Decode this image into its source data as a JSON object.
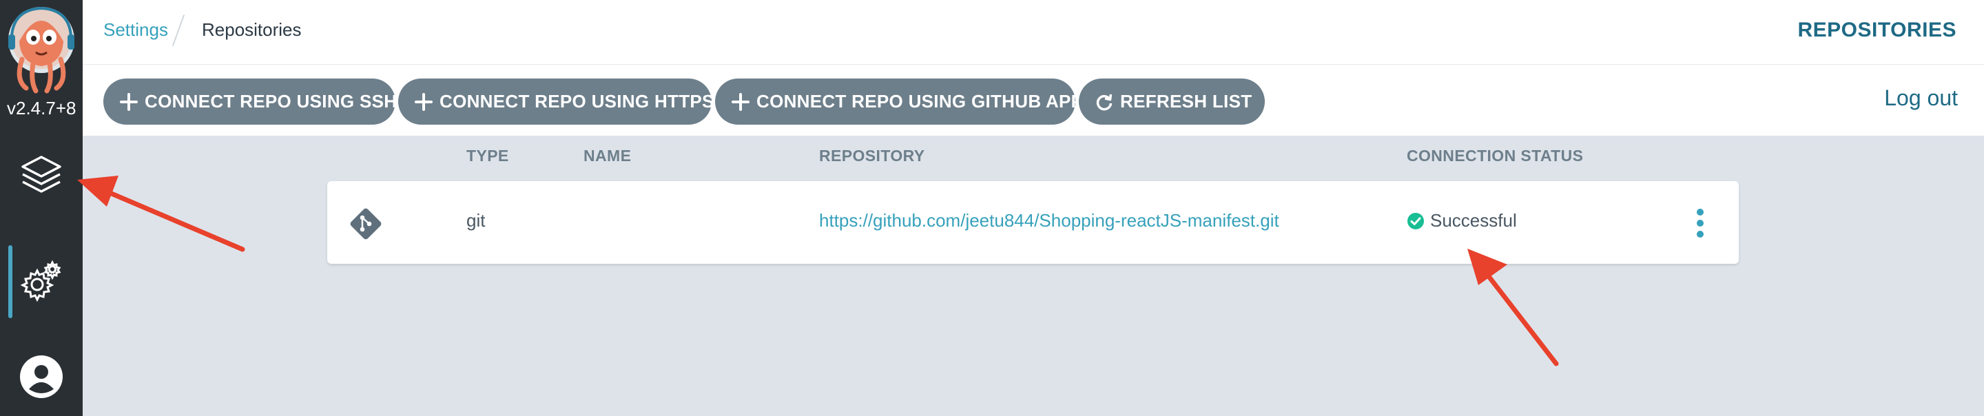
{
  "app": {
    "version": "v2.4.7+8"
  },
  "sidebar": {
    "items": [
      {
        "name": "applications",
        "icon": "layers-icon"
      },
      {
        "name": "settings",
        "icon": "gear-icon",
        "active": true
      },
      {
        "name": "user",
        "icon": "user-icon"
      }
    ]
  },
  "breadcrumb": {
    "parent": "Settings",
    "current": "Repositories"
  },
  "header": {
    "title": "REPOSITORIES",
    "logout": "Log out"
  },
  "toolbar": {
    "connect_ssh": "CONNECT REPO USING SSH",
    "connect_https": "CONNECT REPO USING HTTPS",
    "connect_github_app": "CONNECT REPO USING GITHUB APP",
    "refresh": "REFRESH LIST"
  },
  "table": {
    "columns": [
      "TYPE",
      "NAME",
      "REPOSITORY",
      "CONNECTION STATUS"
    ],
    "rows": [
      {
        "icon": "git-icon",
        "type": "git",
        "name": "",
        "repository": "https://github.com/jeetu844/Shopping-reactJS-manifest.git",
        "status": "Successful"
      }
    ]
  },
  "colors": {
    "sidebar": "#2a2f33",
    "accent": "#36a1bb",
    "button": "#6d7f8b",
    "success": "#18be94",
    "annotation_arrow": "#e8412c"
  }
}
